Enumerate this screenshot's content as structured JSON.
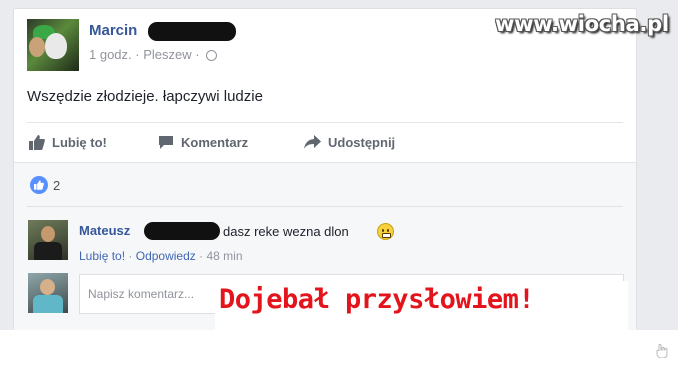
{
  "watermark": "www.wiocha.pl",
  "post": {
    "author_name": "Marcin",
    "time": "1 godz.",
    "location": "Pleszew",
    "meta_separator": "·",
    "text": "Wszędzie złodzieje. łapczywi ludzie"
  },
  "actions": {
    "like_label": "Lubię to!",
    "comment_label": "Komentarz",
    "share_label": "Udostępnij"
  },
  "reactions": {
    "like_count": "2"
  },
  "comment": {
    "author": "Mateusz",
    "text": "dasz reke wezna dlon",
    "like_label": "Lubię to!",
    "reply_label": "Odpowiedz",
    "separator": "·",
    "time": "48 min"
  },
  "write_comment": {
    "placeholder": "Napisz komentarz..."
  },
  "caption": "Dojebał przysłowiem!",
  "colors": {
    "link_blue": "#365899",
    "like_blue": "#5890ff",
    "caption_red": "#e3141b",
    "meta_gray": "#90949c"
  }
}
